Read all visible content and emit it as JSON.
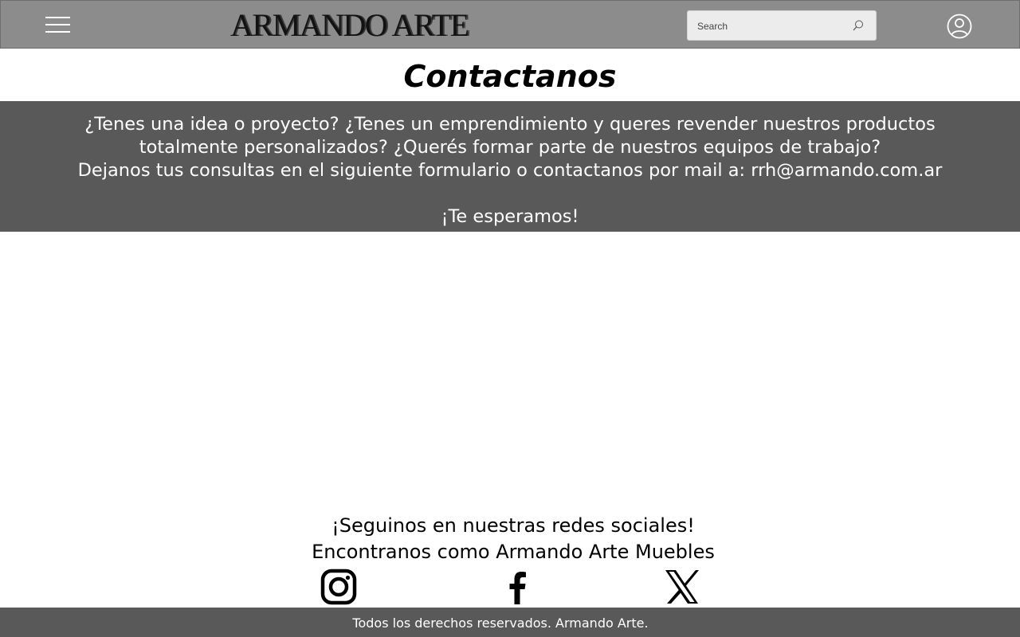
{
  "header": {
    "menu_icon": "hamburger-menu-icon",
    "logo_text": "ARMANDO ARTE",
    "search": {
      "placeholder": "Search",
      "value": "",
      "icon": "search-icon"
    },
    "user_icon": "user-account-icon"
  },
  "main": {
    "title": "Contactanos",
    "banner": {
      "line1": "¿Tenes una idea o proyecto? ¿Tenes un emprendimiento y queres revender nuestros productos",
      "line2": "totalmente personalizados? ¿Querés formar parte de nuestros equipos de trabajo?",
      "line3": "Dejanos tus consultas en el siguiente formulario o contactanos por mail a: rrh@armando.com.ar",
      "line4": "¡Te esperamos!"
    }
  },
  "social": {
    "heading_line1": "¡Seguinos en nuestras redes sociales!",
    "heading_line2": "Encontranos como Armando Arte Muebles",
    "links": [
      {
        "icon": "instagram-icon"
      },
      {
        "icon": "facebook-icon"
      },
      {
        "icon": "x-twitter-icon"
      }
    ]
  },
  "footer": {
    "text": "Todos los derechos reservados. Armando Arte."
  },
  "colors": {
    "header_bg": "#8c8c8c",
    "banner_bg": "#595959",
    "footer_bg": "#595959",
    "text_light": "#ffffff"
  }
}
